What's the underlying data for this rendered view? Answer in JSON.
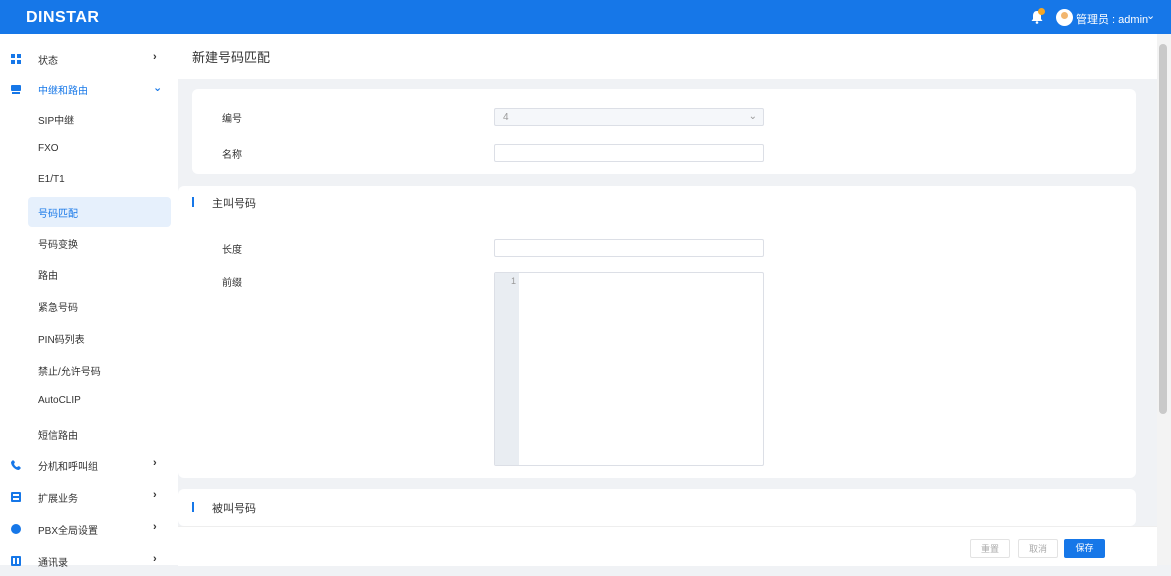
{
  "app": {
    "logo": "DINSTAR",
    "user_label": "管理员 : admin"
  },
  "sidebar": {
    "status": "状态",
    "trunk_routing": "中继和路由",
    "sub_items": [
      "SIP中继",
      "FXO",
      "E1/T1",
      "号码匹配",
      "号码变换",
      "路由",
      "紧急号码",
      "PIN码列表",
      "禁止/允许号码",
      "AutoCLIP",
      "短信路由"
    ],
    "ext_groups": "分机和呼叫组",
    "ext_business": "扩展业务",
    "pbx_global": "PBX全局设置",
    "contacts": "通讯录",
    "chevron_closed": "›",
    "chevron_open": "⌄"
  },
  "page": {
    "title": "新建号码匹配"
  },
  "form": {
    "number_label": "编号",
    "number_value": "4",
    "name_label": "名称",
    "name_value": ""
  },
  "caller": {
    "section_title": "主叫号码",
    "length_label": "长度",
    "length_value": "",
    "prefix_label": "前缀",
    "line_number": "1"
  },
  "callee": {
    "section_title": "被叫号码"
  },
  "footer": {
    "reset": "重置",
    "cancel": "取消",
    "save": "保存"
  },
  "colors": {
    "primary": "#1677e8",
    "sidebar_active_bg": "#e6f0fc",
    "background": "#f0f2f5"
  },
  "icons": {
    "status": "dashboard-icon",
    "trunk_routing": "server-icon",
    "ext_groups": "phone-icon",
    "ext_business": "apps-icon",
    "pbx_global": "globe-icon",
    "contacts": "contacts-icon"
  }
}
